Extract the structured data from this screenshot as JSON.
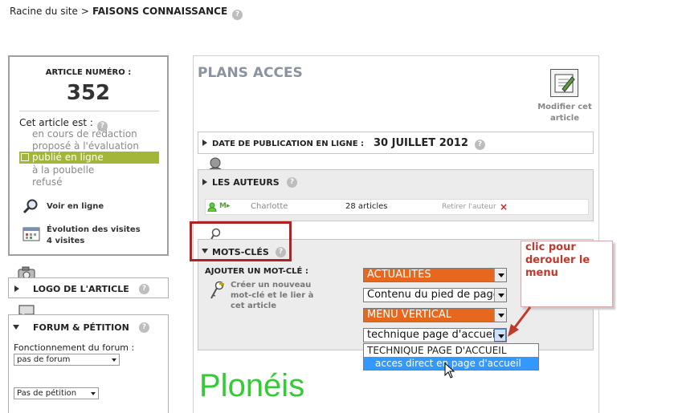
{
  "breadcrumb": {
    "root": "Racine du site",
    "separator": ">",
    "current": "FAISONS CONNAISSANCE",
    "help": "?"
  },
  "article": {
    "number_label": "ARTICLE NUMÉRO :",
    "number": "352",
    "status_title": "Cet article est :",
    "statuses": [
      "en cours de rédaction",
      "proposé à l'évaluation",
      "publié en ligne",
      "à la poubelle",
      "refusé"
    ],
    "view_online": "Voir en ligne",
    "visits_title": "Évolution des visites",
    "visits_count": "4 visites"
  },
  "logo_section": {
    "title": "LOGO DE L'ARTICLE"
  },
  "forum_section": {
    "title": "FORUM & PÉTITION",
    "forum_label": "Fonctionnement du forum :",
    "forum_value": "pas de forum",
    "petition_value": "Pas de pétition"
  },
  "main": {
    "title": "PLANS ACCES",
    "edit_label_line1": "Modifier cet",
    "edit_label_line2": "article",
    "date_label": "DATE DE PUBLICATION EN LIGNE :",
    "date_value": "30 JUILLET 2012",
    "authors_title": "LES AUTEURS",
    "author": {
      "name": "Charlotte",
      "count": "28 articles",
      "remove": "Retirer l'auteur"
    },
    "keywords_title": "MOTS-CLÉS",
    "add_keyword": "AJOUTER UN MOT-CLÉ :",
    "create_keyword_l1": "Créer un nouveau",
    "create_keyword_l2": "mot-clé et le lier à",
    "create_keyword_l3": "cet article",
    "keyword_selects": [
      "ACTUALITES",
      "Contenu du pied de page",
      "MENU VERTICAL",
      "technique page d'accueil"
    ],
    "dropdown_options": [
      "TECHNIQUE PAGE D'ACCUEIL",
      "acces direct en page d'accueil"
    ],
    "brand": "Plonéis"
  },
  "annotation": {
    "line1": "clic pour",
    "line2": "derouler le",
    "line3": "menu"
  },
  "colors": {
    "accent_orange": "#e8671f",
    "published_green": "#a4b63a",
    "highlight_red": "#b22222",
    "selected_blue": "#3399ff",
    "brand_green": "#33cc33"
  }
}
